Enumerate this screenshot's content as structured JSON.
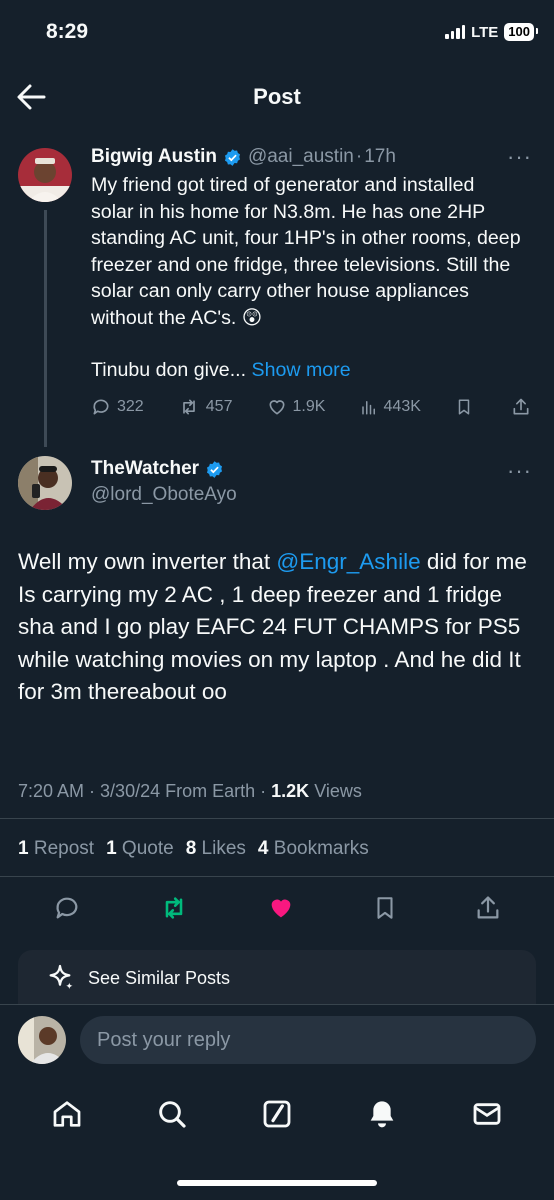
{
  "status_bar": {
    "time": "8:29",
    "network": "LTE",
    "battery": "100"
  },
  "header": {
    "title": "Post"
  },
  "parent_tweet": {
    "name": "Bigwig Austin",
    "handle": "@aai_austin",
    "time": "17h",
    "text": "My friend got tired of generator and installed solar in his home for N3.8m. He has one 2HP standing AC unit, four 1HP's in other rooms, deep freezer and one fridge, three televisions. Still the solar can only carry other house appliances without the AC's. 😲",
    "text2": "Tinubu don give...",
    "show_more": "Show more",
    "replies": "322",
    "reposts": "457",
    "likes": "1.9K",
    "views": "443K"
  },
  "main_tweet": {
    "name": "TheWatcher",
    "handle": "@lord_ObotеAyo",
    "text_before": "Well my own inverter that ",
    "mention": "@Engr_Ashile",
    "text_after": " did for me\nIs carrying my 2 AC , 1 deep freezer and 1 fridge sha and I go play EAFC 24 FUT CHAMPS for PS5 while watching movies on my laptop . And he did It for 3m thereabout oo",
    "time": "7:20 AM",
    "date": "3/30/24",
    "location": "From Earth",
    "views_count": "1.2K",
    "views_label": "Views",
    "reposts_count": "1",
    "reposts_label": "Repost",
    "quotes_count": "1",
    "quotes_label": "Quote",
    "likes_count": "8",
    "likes_label": "Likes",
    "bookmarks_count": "4",
    "bookmarks_label": "Bookmarks"
  },
  "similar_posts": {
    "label": "See Similar Posts"
  },
  "reply": {
    "placeholder": "Post your reply"
  },
  "colors": {
    "background": "#15202b",
    "accent": "#1d9bf0",
    "like": "#f91880",
    "repost": "#00ba7c",
    "muted": "#8b98a5"
  },
  "icons": [
    "back-arrow-icon",
    "verified-icon",
    "reply-icon",
    "repost-icon",
    "like-icon",
    "views-icon",
    "bookmark-icon",
    "share-icon",
    "sparkle-icon",
    "home-icon",
    "search-icon",
    "grok-icon",
    "bell-icon",
    "mail-icon"
  ]
}
